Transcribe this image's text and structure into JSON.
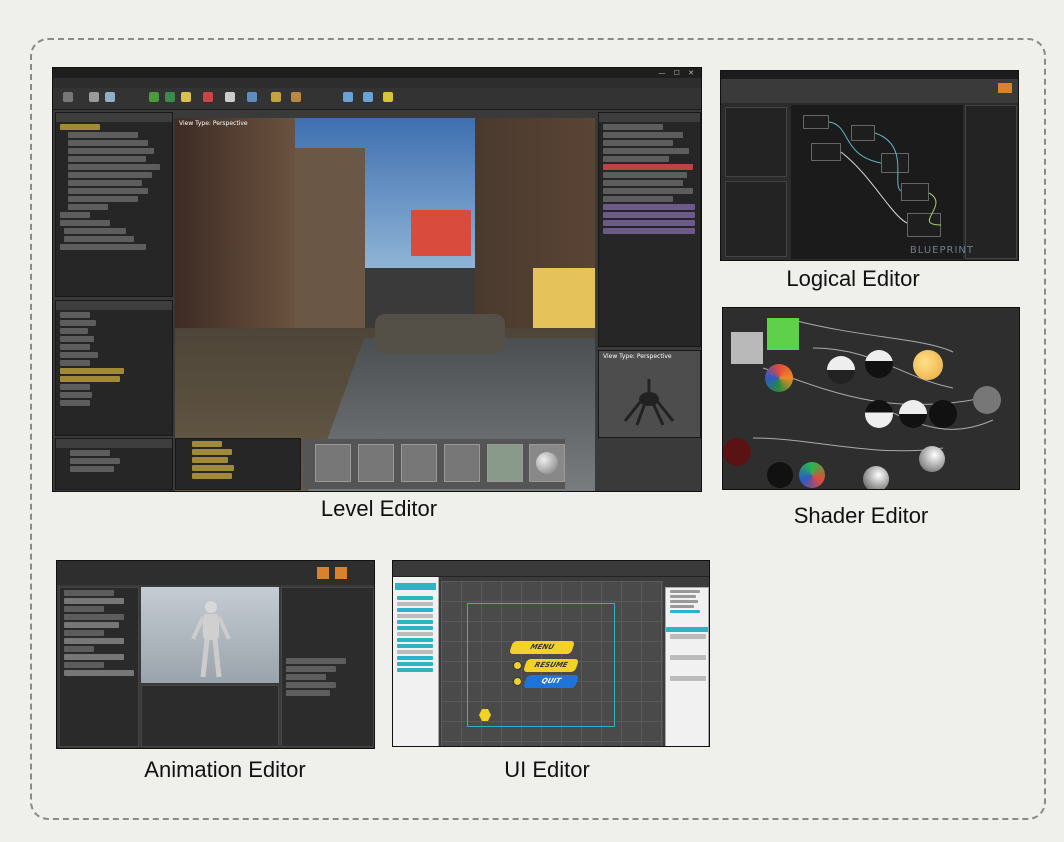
{
  "captions": {
    "level": "Level Editor",
    "logical": "Logical Editor",
    "shader": "Shader Editor",
    "animation": "Animation Editor",
    "ui": "UI Editor"
  },
  "level_editor": {
    "viewport_label": "View Type: Perspective",
    "preview_label": "View Type: Perspective"
  },
  "logical_editor": {
    "watermark": "BLUEPRINT"
  },
  "ui_editor": {
    "buttons": [
      "MENU",
      "RESUME",
      "QUIT"
    ]
  }
}
